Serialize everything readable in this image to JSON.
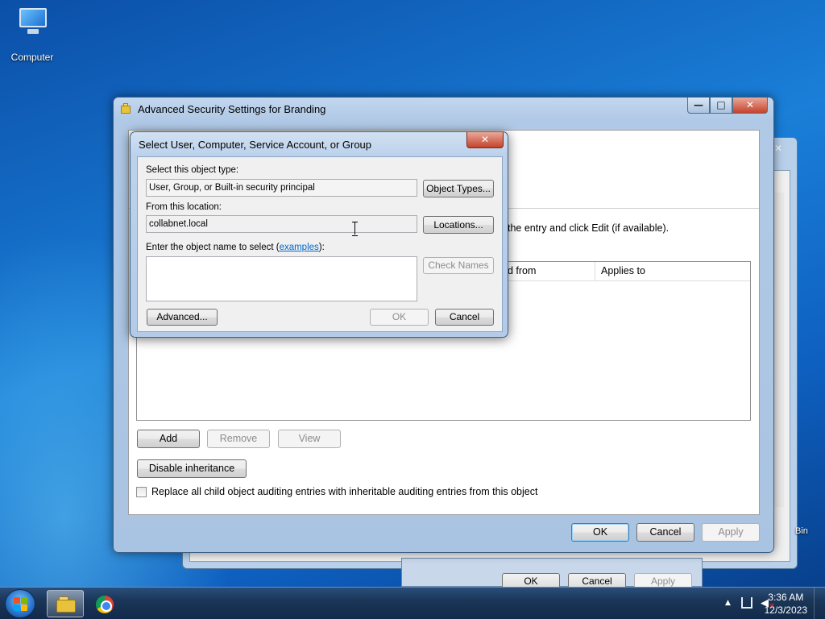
{
  "desktop": {
    "computer_label": "Computer",
    "recycle_label": "Bin"
  },
  "main_window": {
    "title": "Advanced Security Settings for Branding",
    "hint": "the entry and click Edit (if available).",
    "columns": [
      "d from",
      "Applies to"
    ],
    "add_label": "Add",
    "remove_label": "Remove",
    "view_label": "View",
    "disable_inheritance_label": "Disable inheritance",
    "replace_child_label": "Replace all child object auditing entries with inheritable auditing entries from this object",
    "replace_child_checked": false,
    "ok_label": "OK",
    "cancel_label": "Cancel",
    "apply_label": "Apply"
  },
  "back_window": {
    "ok_label": "OK",
    "cancel_label": "Cancel",
    "apply_label": "Apply"
  },
  "dialog": {
    "title": "Select User, Computer, Service Account, or Group",
    "object_type_label": "Select this object type:",
    "object_type_value": "User, Group, or Built-in security principal",
    "object_types_button": "Object Types...",
    "location_label": "From this location:",
    "location_value": "collabnet.local",
    "locations_button": "Locations...",
    "enter_name_label_prefix": "Enter the object name to select (",
    "enter_name_link": "examples",
    "enter_name_label_suffix": "):",
    "object_name_value": "",
    "check_names_button": "Check Names",
    "advanced_button": "Advanced...",
    "ok_button": "OK",
    "cancel_button": "Cancel"
  },
  "taskbar": {
    "time": "3:36 AM",
    "date": "12/3/2023"
  },
  "colors": {
    "link": "#0066cc",
    "close_red": "#c4432b",
    "disabled_text": "#8d8d8d"
  }
}
